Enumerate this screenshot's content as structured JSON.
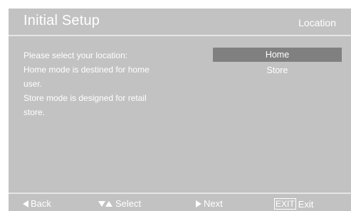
{
  "header": {
    "title": "Initial Setup",
    "section": "Location"
  },
  "description": {
    "lines": [
      "Please select your location:",
      "Home mode is destined for home",
      "user.",
      "Store mode is designed for retail",
      "store."
    ]
  },
  "location_options": [
    {
      "label": "Home",
      "selected": true
    },
    {
      "label": "Store",
      "selected": false
    }
  ],
  "footer": {
    "back_label": "Back",
    "select_label": "Select",
    "next_label": "Next",
    "exit_key": "EXIT",
    "exit_label": "Exit"
  },
  "colors": {
    "background": "#c2c2c2",
    "highlight": "#808080",
    "text": "#ffffff"
  },
  "icons": {
    "back": "triangle-left-icon",
    "select": "triangle-up-down-icon",
    "next": "triangle-right-icon",
    "exit": "exit-key-icon"
  }
}
